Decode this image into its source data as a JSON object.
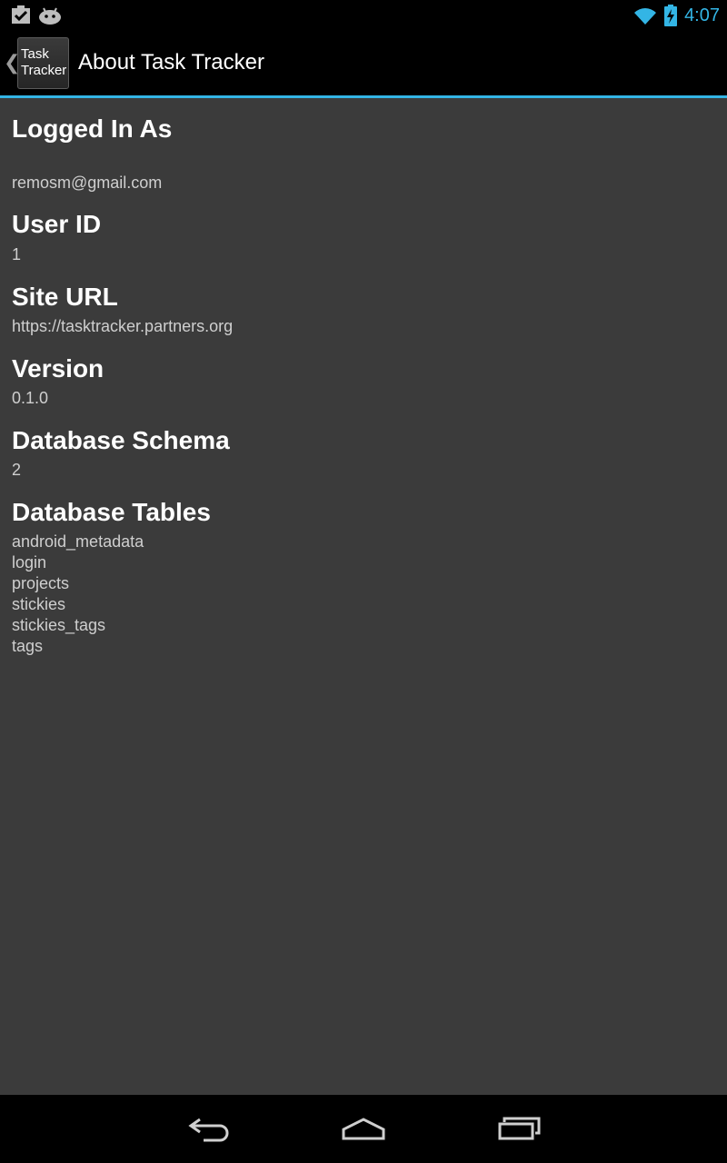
{
  "status_bar": {
    "left_icons": [
      "task-checklist-icon",
      "android-icon"
    ],
    "right_icons": [
      "wifi-icon",
      "battery-charging-icon"
    ],
    "time": "4:07"
  },
  "action_bar": {
    "up_caret": "❮",
    "app_icon_text": [
      "Task",
      "Tracker"
    ],
    "title": "About Task Tracker"
  },
  "sections": {
    "logged_in": {
      "heading": "Logged In As",
      "value": "remosm@gmail.com"
    },
    "user_id": {
      "heading": "User ID",
      "value": "1"
    },
    "site_url": {
      "heading": "Site URL",
      "value": "https://tasktracker.partners.org"
    },
    "version": {
      "heading": "Version",
      "value": "0.1.0"
    },
    "db_schema": {
      "heading": "Database Schema",
      "value": "2"
    },
    "db_tables": {
      "heading": "Database Tables",
      "items": [
        "android_metadata",
        "login",
        "projects",
        "stickies",
        "stickies_tags",
        "tags"
      ]
    }
  },
  "nav_bar": {
    "buttons": [
      "back-icon",
      "home-icon",
      "recent-apps-icon"
    ]
  },
  "colors": {
    "accent": "#33b5e5",
    "background": "#3b3b3b",
    "bar": "#000000"
  }
}
